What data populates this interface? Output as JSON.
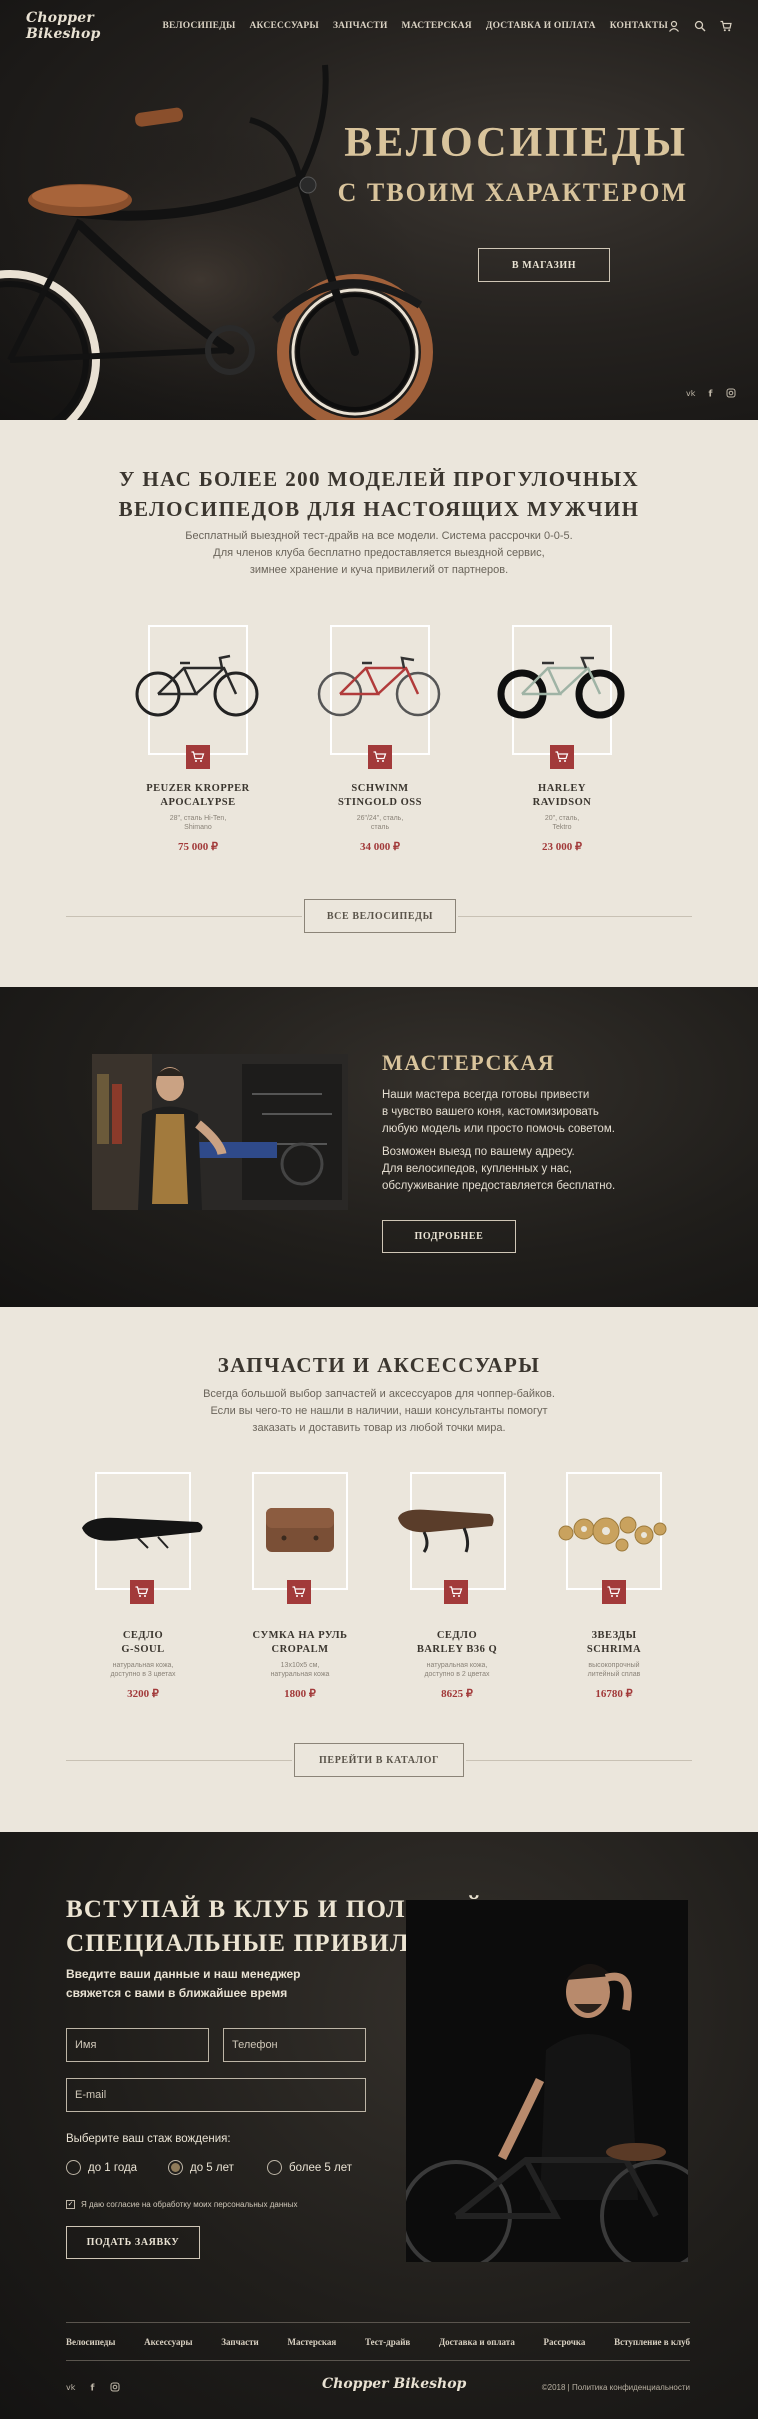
{
  "brand": {
    "logo": "Chopper Bikeshop"
  },
  "nav": {
    "items": [
      "ВЕЛОСИПЕДЫ",
      "АКСЕССУАРЫ",
      "ЗАПЧАСТИ",
      "МАСТЕРСКАЯ",
      "ДОСТАВКА И ОПЛАТА",
      "КОНТАКТЫ"
    ],
    "icons": [
      "user-icon",
      "search-icon",
      "cart-icon"
    ]
  },
  "hero": {
    "title_line1": "ВЕЛОСИПЕДЫ",
    "title_line2": "С ТВОИМ ХАРАКТЕРОМ",
    "button": "В МАГАЗИН",
    "social": [
      "vk-icon",
      "facebook-icon",
      "instagram-icon"
    ]
  },
  "bikes": {
    "title_line1": "У НАС БОЛЕЕ 200 МОДЕЛЕЙ ПРОГУЛОЧНЫХ",
    "title_line2": "ВЕЛОСИПЕДОВ ДЛЯ НАСТОЯЩИХ МУЖЧИН",
    "subtitle_line1": "Бесплатный выездной тест-драйв на все модели. Система рассрочки 0-0-5.",
    "subtitle_line2": "Для членов клуба бесплатно предоставляется выездной сервис,",
    "subtitle_line3": "зимнее хранение и куча привилегий от партнеров.",
    "items": [
      {
        "name1": "PEUZER KROPPER",
        "name2": "APOCALYPSE",
        "desc1": "28\", сталь Hi-Ten,",
        "desc2": "Shimano",
        "price": "75 000 ₽"
      },
      {
        "name1": "SCHWINM",
        "name2": "STINGOLD OSS",
        "desc1": "26\"/24\", сталь,",
        "desc2": "сталь",
        "price": "34 000 ₽"
      },
      {
        "name1": "HARLEY",
        "name2": "RAVIDSON",
        "desc1": "20\", сталь,",
        "desc2": "Tektro",
        "price": "23 000 ₽"
      }
    ],
    "button": "ВСЕ ВЕЛОСИПЕДЫ"
  },
  "workshop": {
    "title": "МАСТЕРСКАЯ",
    "para1_line1": "Наши мастера всегда готовы привести",
    "para1_line2": "в чувство вашего коня, кастомизировать",
    "para1_line3": "любую модель или просто помочь советом.",
    "para2_line1": "Возможен выезд по вашему адресу.",
    "para2_line2": "Для велосипедов, купленных у нас,",
    "para2_line3": "обслуживание предоставляется бесплатно.",
    "button": "ПОДРОБНЕЕ"
  },
  "parts": {
    "title": "ЗАПЧАСТИ И АКСЕССУАРЫ",
    "subtitle_line1": "Всегда большой выбор запчастей и аксессуаров для чоппер-байков.",
    "subtitle_line2": "Если вы чего-то не нашли в наличии, наши консультанты помогут",
    "subtitle_line3": "заказать и доставить товар из любой точки мира.",
    "items": [
      {
        "name1": "СЕДЛО",
        "name2": "G-SOUL",
        "desc1": "натуральная кожа,",
        "desc2": "доступно в 3 цветах",
        "price": "3200 ₽"
      },
      {
        "name1": "СУМКА НА РУЛЬ",
        "name2": "CROPALM",
        "desc1": "13x10x5 см,",
        "desc2": "натуральная кожа",
        "price": "1800 ₽"
      },
      {
        "name1": "СЕДЛО",
        "name2": "BARLEY B36 Q",
        "desc1": "натуральная кожа,",
        "desc2": "доступно в 2 цветах",
        "price": "8625 ₽"
      },
      {
        "name1": "ЗВЕЗДЫ",
        "name2": "SCHRIMA",
        "desc1": "высокопрочный",
        "desc2": "литейный сплав",
        "price": "16780 ₽"
      }
    ],
    "button": "ПЕРЕЙТИ В КАТАЛОГ"
  },
  "club": {
    "title_line1": "ВСТУПАЙ В КЛУБ И ПОЛУЧАЙ",
    "title_line2": "СПЕЦИАЛЬНЫЕ ПРИВИЛЕГИИ",
    "subtitle_line1": "Введите ваши данные и наш менеджер",
    "subtitle_line2": "свяжется с вами в ближайшее время",
    "name_placeholder": "Имя",
    "phone_placeholder": "Телефон",
    "email_placeholder": "E-mail",
    "experience_label": "Выберите ваш стаж вождения:",
    "options": [
      "до 1 года",
      "до 5 лет",
      "более 5 лет"
    ],
    "selected_option": "до 5 лет",
    "consent": "Я даю согласие на обработку моих персональных данных",
    "submit": "ПОДАТЬ ЗАЯВКУ"
  },
  "footer": {
    "links": [
      "Велосипеды",
      "Аксессуары",
      "Запчасти",
      "Мастерская",
      "Тест-драйв",
      "Доставка и оплата",
      "Рассрочка",
      "Вступление в клуб"
    ],
    "logo": "Chopper Bikeshop",
    "copyright": "©2018  |  Политика конфиденциальности",
    "social": [
      "vk-icon",
      "facebook-icon",
      "instagram-icon"
    ]
  },
  "colors": {
    "accent": "#a23a3a",
    "gold": "#d9c49c",
    "light_bg": "#ebe6dc",
    "dark_bg": "#201e1b"
  }
}
